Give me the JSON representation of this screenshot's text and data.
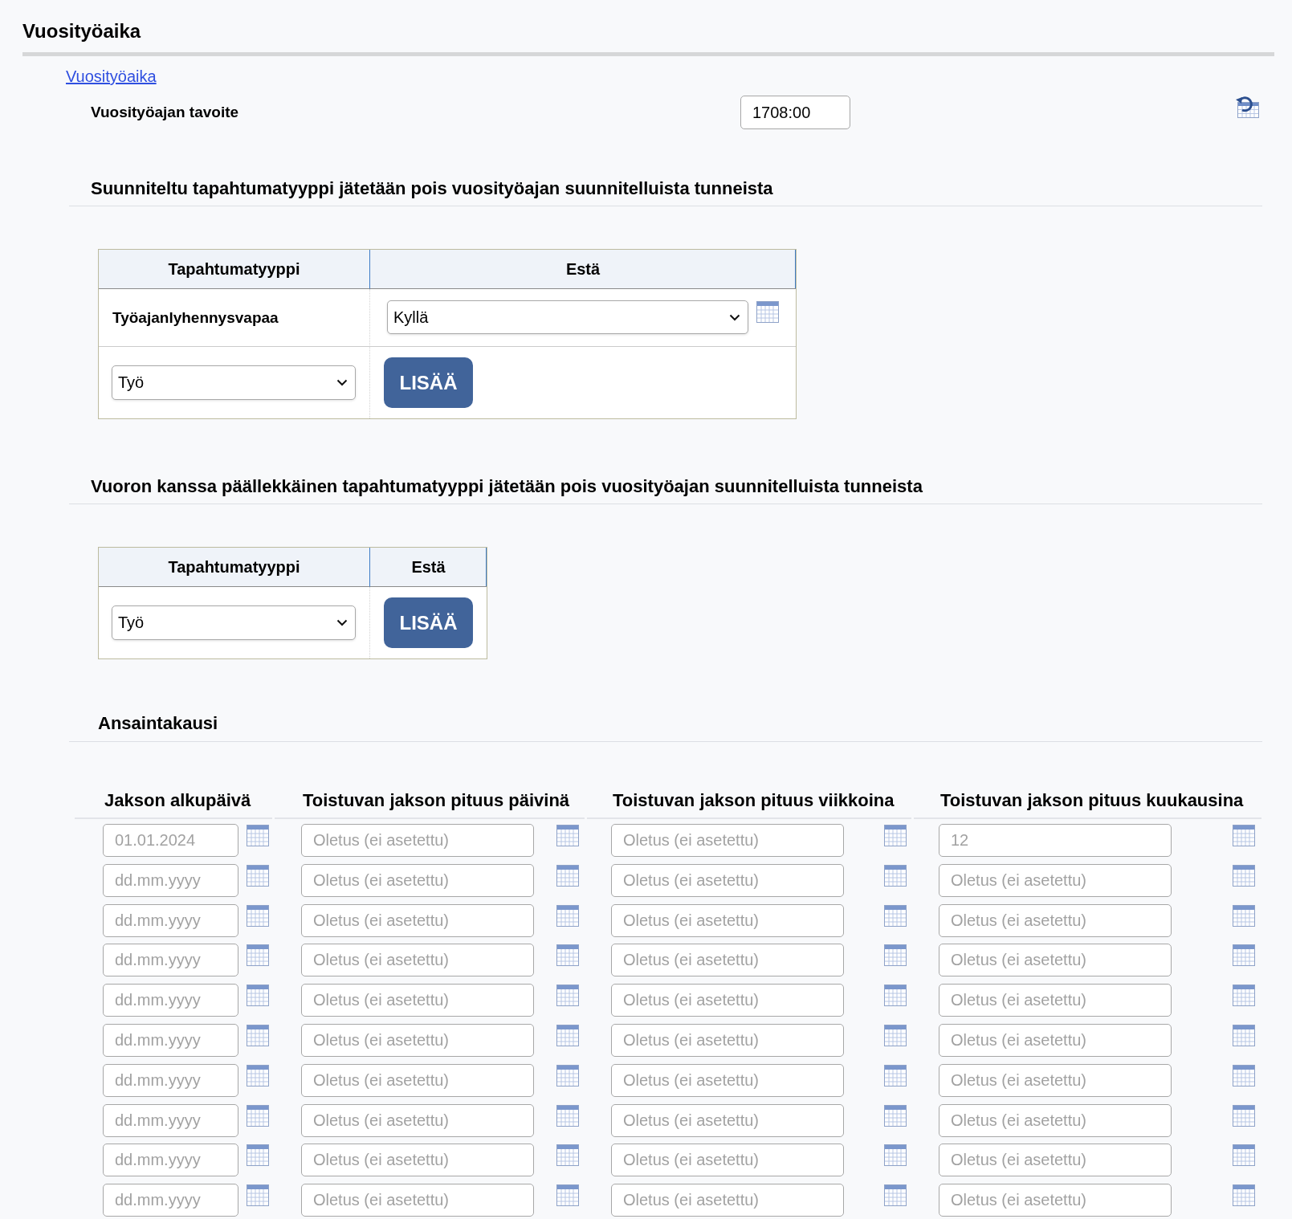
{
  "title": "Vuosityöaika",
  "link": "Vuosityöaika",
  "annual_target": {
    "label": "Vuosityöajan tavoite",
    "value": "1708:00"
  },
  "planned_exclusions": {
    "heading": "Suunniteltu tapahtumatyyppi jätetään pois vuosityöajan suunnitelluista tunneista",
    "columns": [
      "Tapahtumatyyppi",
      "Estä"
    ],
    "rows": [
      {
        "event_type": "Työajanlyhennysvapaa",
        "block": "Kyllä"
      }
    ],
    "new_row": {
      "event_type": "Työ",
      "button": "LISÄÄ"
    }
  },
  "overlap_exclusions": {
    "heading": "Vuoron kanssa päällekkäinen tapahtumatyyppi jätetään pois vuosityöajan suunnitelluista tunneista",
    "columns": [
      "Tapahtumatyyppi",
      "Estä"
    ],
    "new_row": {
      "event_type": "Työ",
      "button": "LISÄÄ"
    }
  },
  "earning_period": {
    "heading": "Ansaintakausi",
    "columns": [
      "Jakson alkupäivä",
      "Toistuvan jakson pituus päivinä",
      "Toistuvan jakson pituus viikkoina",
      "Toistuvan jakson pituus kuukausina"
    ],
    "rows": [
      {
        "cells": [
          {
            "placeholder": "01.01.2024"
          },
          {
            "placeholder": "Oletus (ei asetettu)"
          },
          {
            "placeholder": "Oletus (ei asetettu)"
          },
          {
            "placeholder": "12"
          }
        ]
      },
      {
        "cells": [
          {
            "placeholder": "dd.mm.yyyy"
          },
          {
            "placeholder": "Oletus (ei asetettu)"
          },
          {
            "placeholder": "Oletus (ei asetettu)"
          },
          {
            "placeholder": "Oletus (ei asetettu)"
          }
        ]
      },
      {
        "cells": [
          {
            "placeholder": "dd.mm.yyyy"
          },
          {
            "placeholder": "Oletus (ei asetettu)"
          },
          {
            "placeholder": "Oletus (ei asetettu)"
          },
          {
            "placeholder": "Oletus (ei asetettu)"
          }
        ]
      },
      {
        "cells": [
          {
            "placeholder": "dd.mm.yyyy"
          },
          {
            "placeholder": "Oletus (ei asetettu)"
          },
          {
            "placeholder": "Oletus (ei asetettu)"
          },
          {
            "placeholder": "Oletus (ei asetettu)"
          }
        ]
      },
      {
        "cells": [
          {
            "placeholder": "dd.mm.yyyy"
          },
          {
            "placeholder": "Oletus (ei asetettu)"
          },
          {
            "placeholder": "Oletus (ei asetettu)"
          },
          {
            "placeholder": "Oletus (ei asetettu)"
          }
        ]
      },
      {
        "cells": [
          {
            "placeholder": "dd.mm.yyyy"
          },
          {
            "placeholder": "Oletus (ei asetettu)"
          },
          {
            "placeholder": "Oletus (ei asetettu)"
          },
          {
            "placeholder": "Oletus (ei asetettu)"
          }
        ]
      },
      {
        "cells": [
          {
            "placeholder": "dd.mm.yyyy"
          },
          {
            "placeholder": "Oletus (ei asetettu)"
          },
          {
            "placeholder": "Oletus (ei asetettu)"
          },
          {
            "placeholder": "Oletus (ei asetettu)"
          }
        ]
      },
      {
        "cells": [
          {
            "placeholder": "dd.mm.yyyy"
          },
          {
            "placeholder": "Oletus (ei asetettu)"
          },
          {
            "placeholder": "Oletus (ei asetettu)"
          },
          {
            "placeholder": "Oletus (ei asetettu)"
          }
        ]
      },
      {
        "cells": [
          {
            "placeholder": "dd.mm.yyyy"
          },
          {
            "placeholder": "Oletus (ei asetettu)"
          },
          {
            "placeholder": "Oletus (ei asetettu)"
          },
          {
            "placeholder": "Oletus (ei asetettu)"
          }
        ]
      },
      {
        "cells": [
          {
            "placeholder": "dd.mm.yyyy"
          },
          {
            "placeholder": "Oletus (ei asetettu)"
          },
          {
            "placeholder": "Oletus (ei asetettu)"
          },
          {
            "placeholder": "Oletus (ei asetettu)"
          }
        ]
      }
    ]
  }
}
